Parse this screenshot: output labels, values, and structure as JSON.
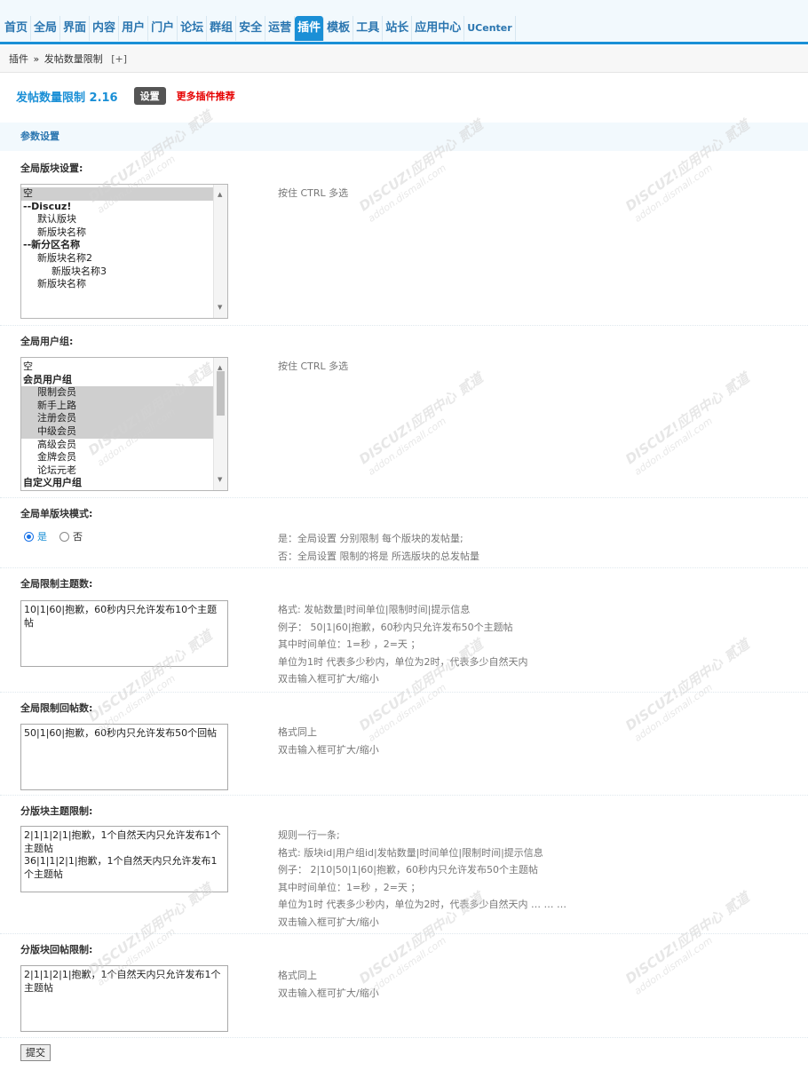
{
  "nav": {
    "items": [
      "首页",
      "全局",
      "界面",
      "内容",
      "用户",
      "门户",
      "论坛",
      "群组",
      "安全",
      "运营",
      "插件",
      "模板",
      "工具",
      "站长",
      "应用中心",
      "UCenter"
    ],
    "active": "插件"
  },
  "breadcrumb": {
    "root": "插件",
    "sep": "»",
    "current": "发帖数量限制",
    "add": "[+]"
  },
  "plugin": {
    "title": "发帖数量限制 2.16",
    "settings_tab": "设置",
    "more_link": "更多插件推荐"
  },
  "section_title": "参数设置",
  "settings": {
    "forums": {
      "label": "全局版块设置:",
      "tip": "按住 CTRL 多选",
      "options": [
        {
          "text": "空",
          "indent": 0,
          "selected": true,
          "group": false
        },
        {
          "text": "--Discuz!",
          "indent": 0,
          "selected": false,
          "group": true
        },
        {
          "text": "默认版块",
          "indent": 1,
          "selected": false,
          "group": false
        },
        {
          "text": "新版块名称",
          "indent": 1,
          "selected": false,
          "group": false
        },
        {
          "text": "--新分区名称",
          "indent": 0,
          "selected": false,
          "group": true
        },
        {
          "text": "新版块名称2",
          "indent": 1,
          "selected": false,
          "group": false
        },
        {
          "text": "新版块名称3",
          "indent": 2,
          "selected": false,
          "group": false
        },
        {
          "text": "新版块名称",
          "indent": 1,
          "selected": false,
          "group": false
        }
      ]
    },
    "usergroups": {
      "label": "全局用户组:",
      "tip": "按住 CTRL 多选",
      "options": [
        {
          "text": "空",
          "indent": 0,
          "selected": false,
          "group": false
        },
        {
          "text": "会员用户组",
          "indent": 0,
          "selected": false,
          "group": true
        },
        {
          "text": "限制会员",
          "indent": 1,
          "selected": true,
          "group": false
        },
        {
          "text": "新手上路",
          "indent": 1,
          "selected": true,
          "group": false
        },
        {
          "text": "注册会员",
          "indent": 1,
          "selected": true,
          "group": false
        },
        {
          "text": "中级会员",
          "indent": 1,
          "selected": true,
          "group": false
        },
        {
          "text": "高级会员",
          "indent": 1,
          "selected": false,
          "group": false
        },
        {
          "text": "金牌会员",
          "indent": 1,
          "selected": false,
          "group": false
        },
        {
          "text": "论坛元老",
          "indent": 1,
          "selected": false,
          "group": false
        },
        {
          "text": "自定义用户组",
          "indent": 0,
          "selected": false,
          "group": true
        }
      ]
    },
    "single_mode": {
      "label": "全局单版块模式:",
      "yes": "是",
      "no": "否",
      "value": "是",
      "tip_lines": [
        "是：全局设置 分别限制 每个版块的发帖量;",
        "否：全局设置 限制的将是 所选版块的总发帖量"
      ]
    },
    "thread_limit": {
      "label": "全局限制主题数:",
      "value": "10|1|60|抱歉，60秒内只允许发布10个主题帖",
      "tip_lines": [
        "格式: 发帖数量|时间单位|限制时间|提示信息",
        "例子： 50|1|60|抱歉，60秒内只允许发布50个主题帖",
        "其中时间单位：1=秒 ，2=天 ；",
        "单位为1时 代表多少秒内，单位为2时，代表多少自然天内",
        "双击输入框可扩大/缩小"
      ]
    },
    "reply_limit": {
      "label": "全局限制回帖数:",
      "value": "50|1|60|抱歉，60秒内只允许发布50个回帖",
      "tip_lines": [
        "格式同上",
        "双击输入框可扩大/缩小"
      ]
    },
    "forum_thread_limit": {
      "label": "分版块主题限制:",
      "value": "2|1|1|2|1|抱歉，1个自然天内只允许发布1个主题帖\n36|1|1|2|1|抱歉，1个自然天内只允许发布1个主题帖",
      "tip_lines": [
        "规则一行一条;",
        "格式: 版块id|用户组id|发帖数量|时间单位|限制时间|提示信息",
        "例子： 2|10|50|1|60|抱歉，60秒内只允许发布50个主题帖",
        "其中时间单位：1=秒 ，2=天 ；",
        "单位为1时 代表多少秒内，单位为2时，代表多少自然天内 … … …",
        "双击输入框可扩大/缩小"
      ]
    },
    "forum_reply_limit": {
      "label": "分版块回帖限制:",
      "value": "2|1|1|2|1|抱歉，1个自然天内只允许发布1个主题帖",
      "tip_lines": [
        "格式同上",
        "双击输入框可扩大/缩小"
      ]
    }
  },
  "submit_label": "提交",
  "watermark": {
    "brand": "DISCUZ!应用中心",
    "site": "addon.dismall.com",
    "mark": "贰道"
  }
}
